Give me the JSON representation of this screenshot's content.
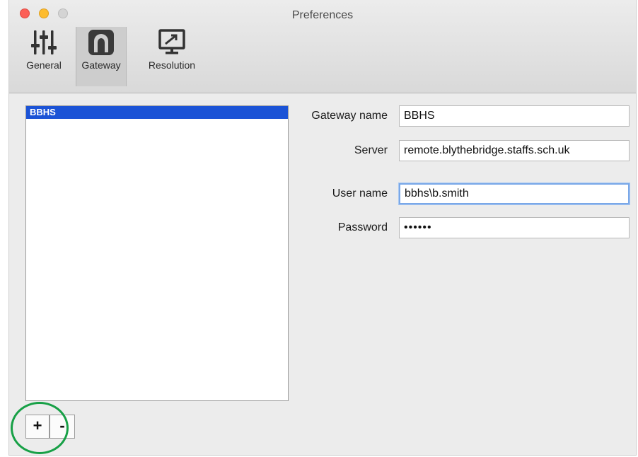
{
  "window": {
    "title": "Preferences"
  },
  "toolbar": {
    "items": [
      {
        "label": "General",
        "icon": "sliders-icon"
      },
      {
        "label": "Gateway",
        "icon": "tunnel-icon",
        "selected": true
      },
      {
        "label": "Resolution",
        "icon": "monitor-icon"
      }
    ]
  },
  "gateways": {
    "items": [
      {
        "name": "BBHS",
        "selected": true
      }
    ]
  },
  "buttons": {
    "add": "+",
    "remove": "-"
  },
  "form": {
    "gateway_name": {
      "label": "Gateway name",
      "value": "BBHS"
    },
    "server": {
      "label": "Server",
      "value": "remote.blythebridge.staffs.sch.uk"
    },
    "user_name": {
      "label": "User name",
      "value": "bbhs\\b.smith"
    },
    "password": {
      "label": "Password",
      "value": "••••••"
    }
  },
  "colors": {
    "selection": "#1b53d6",
    "highlight_circle": "#17a046",
    "focus_ring": "#7aa8e8"
  }
}
